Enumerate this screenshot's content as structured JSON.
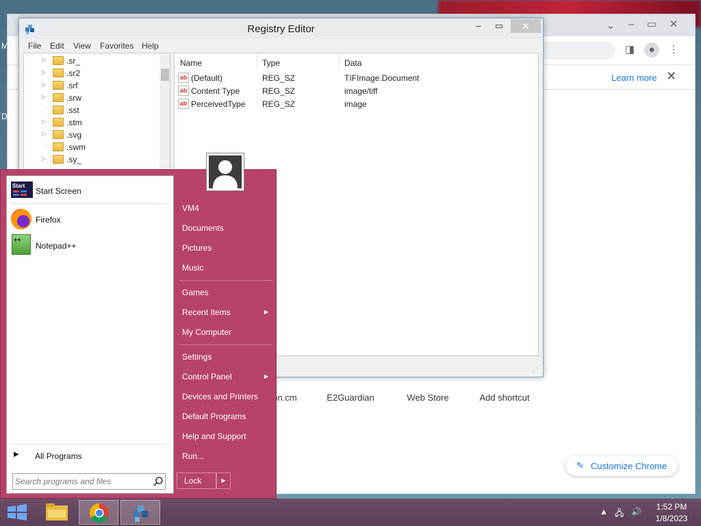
{
  "desktop": {
    "label_m": "M",
    "label_d": "D"
  },
  "chrome": {
    "learn_more": "Learn more",
    "shortcuts": [
      "on.cm",
      "E2Guardian",
      "Web Store",
      "Add shortcut"
    ],
    "customize_label": "Customize Chrome",
    "accent": "#1a73e8"
  },
  "regedit": {
    "title": "Registry Editor",
    "menu": [
      "File",
      "Edit",
      "View",
      "Favorites",
      "Help"
    ],
    "tree_items": [
      ".sr_",
      ".sr2",
      ".srf",
      ".srw",
      ".sst",
      ".stm",
      ".svg",
      ".swm",
      ".sy_"
    ],
    "columns": [
      "Name",
      "Type",
      "Data"
    ],
    "values": [
      {
        "name": "(Default)",
        "type": "REG_SZ",
        "data": "TIFImage.Document"
      },
      {
        "name": "Content Type",
        "type": "REG_SZ",
        "data": "image/tiff"
      },
      {
        "name": "PerceivedType",
        "type": "REG_SZ",
        "data": "image"
      }
    ]
  },
  "startmenu": {
    "pinned": [
      "Start Screen",
      "Firefox",
      "Notepad++"
    ],
    "start_icon_text": "Start",
    "all_programs": "All Programs",
    "search_placeholder": "Search programs and files",
    "right_items": [
      "VM4",
      "Documents",
      "Pictures",
      "Music",
      "Games",
      "Recent Items",
      "My Computer",
      "Settings",
      "Control Panel",
      "Devices and Printers",
      "Default Programs",
      "Help and Support",
      "Run..."
    ],
    "lock_label": "Lock",
    "accent": "#b8436a"
  },
  "taskbar": {
    "time": "1:52 PM",
    "date": "1/8/2023"
  }
}
